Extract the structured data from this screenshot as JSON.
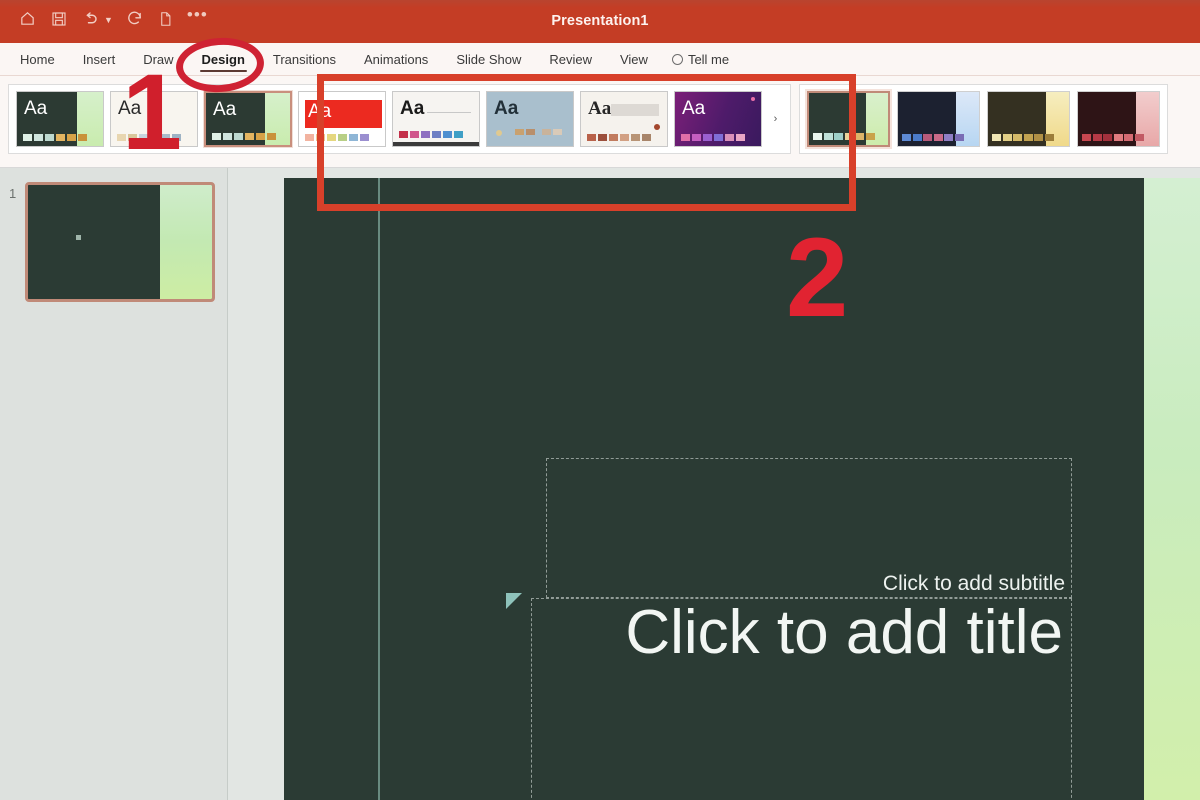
{
  "window": {
    "title": "Presentation1",
    "accent_red": "#c43d25",
    "slide_bg": "#2b3b34"
  },
  "quick_access": [
    {
      "name": "home-icon",
      "label": "Home"
    },
    {
      "name": "save-icon",
      "label": "Save"
    },
    {
      "name": "undo-icon",
      "label": "Undo"
    },
    {
      "name": "redo-icon",
      "label": "Redo"
    },
    {
      "name": "new-file-icon",
      "label": "New"
    },
    {
      "name": "more-icon",
      "label": "…"
    }
  ],
  "tabs": [
    {
      "label": "Home",
      "active": false
    },
    {
      "label": "Insert",
      "active": false
    },
    {
      "label": "Draw",
      "active": false
    },
    {
      "label": "Design",
      "active": true
    },
    {
      "label": "Transitions",
      "active": false
    },
    {
      "label": "Animations",
      "active": false
    },
    {
      "label": "Slide Show",
      "active": false
    },
    {
      "label": "Review",
      "active": false
    },
    {
      "label": "View",
      "active": false
    }
  ],
  "tell_me": {
    "label": "Tell me"
  },
  "ribbon": {
    "themes": [
      {
        "name": "theme-green",
        "aa": "Aa",
        "bg": "#2c3a33",
        "aa_color": "#ffffff",
        "strip": "#cdeabc",
        "swatches": [
          "#dff0e6",
          "#cfe4dd",
          "#bcd8cf",
          "#e3b460",
          "#d7a247",
          "#c9923a"
        ],
        "selected": false
      },
      {
        "name": "theme-cream",
        "aa": "Aa",
        "bg": "#f7f4ef",
        "aa_color": "#2a2a2a",
        "strip": "",
        "swatches": [
          "#e8d6b0",
          "#d9c79c",
          "#c8d4dd",
          "#b6c6d4",
          "#a9bccb",
          "#9db2c4"
        ],
        "selected": false
      },
      {
        "name": "theme-green-2",
        "aa": "Aa",
        "bg": "#2c3a33",
        "aa_color": "#ffffff",
        "strip": "#cdeabc",
        "swatches": [
          "#dff0e6",
          "#cfe4dd",
          "#bcd8cf",
          "#e3b460",
          "#d7a247",
          "#c9923a"
        ],
        "selected": true
      },
      {
        "name": "theme-red",
        "aa": "Aa",
        "bg": "#ffffff",
        "aa_color": "#ffffff",
        "strip": "#ec2a20",
        "swatches": [
          "#f2b3a0",
          "#edc892",
          "#e5d77f",
          "#b8cf86",
          "#8fb6d6",
          "#9b8fd0"
        ],
        "selected": false
      },
      {
        "name": "theme-white",
        "aa": "Aa",
        "bg": "#f5f3f0",
        "aa_color": "#1b1b1b",
        "strip": "",
        "swatches": [
          "#c4304a",
          "#d0568c",
          "#8f6fc0",
          "#6e7fc4",
          "#4f8fd0",
          "#3f9fc6"
        ],
        "selected": false
      },
      {
        "name": "theme-bluegrey",
        "aa": "Aa",
        "bg": "#a9bfcd",
        "aa_color": "#223039",
        "strip": "",
        "swatches": [
          "#e0c98f",
          "#c9a16f",
          "#b98f6b",
          "#a88066",
          "#c9b39b",
          "#d9cab8"
        ],
        "selected": false
      },
      {
        "name": "theme-serif",
        "aa": "Aa",
        "bg": "#f4f1ec",
        "aa_color": "#262626",
        "strip": "",
        "swatches": [
          "#b9624a",
          "#9c4f3c",
          "#c17b5e",
          "#d2a083",
          "#b89476",
          "#a8856a"
        ],
        "selected": false
      },
      {
        "name": "theme-purple",
        "aa": "Aa",
        "bg": "#4d1b63",
        "aa_color": "#ffffff",
        "strip": "",
        "swatches": [
          "#e06fa8",
          "#c45ec0",
          "#9a5fd0",
          "#7f6ed6",
          "#d98fb8",
          "#e8a6c4"
        ],
        "selected": false
      }
    ],
    "gallery_more_icon": "›",
    "variants": [
      {
        "name": "variant-green",
        "main": "#2c3a33",
        "strip": "#cfeab8",
        "swatches": [
          "#eaf5ee",
          "#bfe0d8",
          "#9dcfc8",
          "#e9d49a",
          "#ddb569",
          "#c9a24a"
        ],
        "selected": true
      },
      {
        "name": "variant-navy",
        "main": "#1c2130",
        "strip": "#cfe0f5",
        "swatches": [
          "#5e8ad4",
          "#4b7bc9",
          "#b85a7a",
          "#c96a88",
          "#8f7ec4",
          "#7a6db5"
        ],
        "selected": false
      },
      {
        "name": "variant-olive",
        "main": "#343021",
        "strip": "#f2e4a8",
        "swatches": [
          "#f0e6b4",
          "#e2cf86",
          "#d4b968",
          "#c2a250",
          "#b08f45",
          "#9c7d3a"
        ],
        "selected": false
      },
      {
        "name": "variant-maroon",
        "main": "#2e1416",
        "strip": "#f0bfc0",
        "swatches": [
          "#c74750",
          "#b53a46",
          "#a3313d",
          "#e07b7f",
          "#d46a72",
          "#c25a64"
        ],
        "selected": false
      }
    ]
  },
  "slide_panel": {
    "slides": [
      {
        "number": "1"
      }
    ]
  },
  "canvas": {
    "subtitle_placeholder": "Click to add subtitle",
    "title_placeholder": "Click to add title"
  },
  "annotations": [
    {
      "name": "annotation-number-1",
      "text": "1",
      "color": "#d01f2c"
    },
    {
      "name": "annotation-number-2",
      "text": "2",
      "color": "#e12331"
    }
  ]
}
